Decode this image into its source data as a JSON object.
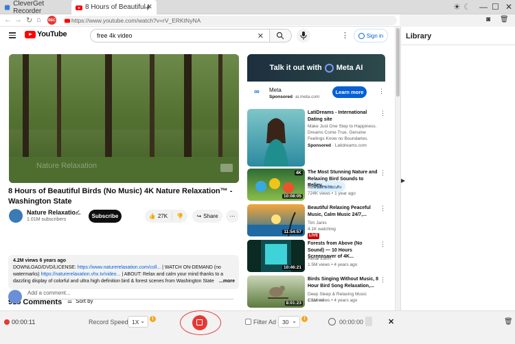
{
  "tabs": [
    {
      "label": "CleverGet Recorder"
    },
    {
      "label": "8 Hours of Beautiful I"
    }
  ],
  "address": {
    "url": "https://www.youtube.com/watch?v=rV_ERKtNyNA",
    "rec_label": "REC"
  },
  "youtube": {
    "logo": "YouTube",
    "search_value": "free 4k video",
    "sign_in": "Sign in"
  },
  "video": {
    "title": "8 Hours of Beautiful Birds (No Music) 4K Nature Relaxation™ - Washington State",
    "watermark": "Nature Relaxation",
    "channel": "Nature Relaxatio...",
    "subscribers": "1.01M subscribers",
    "subscribe": "Subscribe",
    "likes": "27K",
    "share": "Share"
  },
  "description": {
    "meta": "4.2M views  6 years ago",
    "line1_a": "DOWNLOAD/DVD/LICENSE: ",
    "line1_link": "https://www.naturerelaxation.com/coll...",
    "line1_b": " | WATCH ON-DEMAND (no",
    "line2_a": "watermarks) ",
    "line2_link": "https://naturerelaxation.vhx.tv/video...",
    "line2_b": " | ABOUT: Relax and calm your mind thanks to a",
    "line3": "dazzling display of colorful and ultra high definition bird & forest scenes from Washington State",
    "more": "...more"
  },
  "comments": {
    "count": "915 Comments",
    "sort": "Sort by",
    "placeholder": "Add a comment..."
  },
  "ad": {
    "banner": "Talk it out with",
    "banner_brand": "Meta AI",
    "advertiser": "Meta",
    "sponsored": "Sponsored",
    "domain": "· ai.meta.com",
    "learn_more": "Learn more"
  },
  "recommendations": [
    {
      "title": "LatiDreams - International Dating site",
      "desc": "Make Just One Step to Happiness. Dreams Come True. Genuine Feelings Know no Boundaries.",
      "sponsored": "Sponsored",
      "domain": "· Latidreams.com",
      "visit": "Visit site"
    },
    {
      "title": "The Most Stunning Nature and Relaxing Bird Sounds to Reliev...",
      "channel": "Awesome Nature",
      "stats": "724K views  •  1 year ago",
      "duration": "10:08:05",
      "badge": "4K"
    },
    {
      "title": "Beautiful Relaxing Peaceful Music, Calm Music 24/7,...",
      "channel": "Tim Janis",
      "stats": "4.1K watching",
      "live": "LIVE",
      "duration": "11:54:57"
    },
    {
      "title": "Forests from Above (No Sound) — 10 Hours Screensaver of 4K...",
      "channel": "Aerial Earth",
      "stats": "1.5M views  •  4 years ago",
      "duration": "10:46:21"
    },
    {
      "title": "Birds Singing Without Music, 8 Hour Bird Song Relaxation,...",
      "channel": "Deep Sleep & Relaxing Music Channel",
      "stats": "1.1M views  •  4 years ago",
      "duration": "8:01:23"
    }
  ],
  "library": {
    "title": "Library"
  },
  "recorder": {
    "time": "00:00:11",
    "speed_label": "Record Speed :",
    "speed_value": "1X",
    "filter_label": "Filter Ad :",
    "filter_value": "30",
    "timer": "00:00:00"
  },
  "colors": {
    "accent_red": "#e53935",
    "yt_red": "#ff0000",
    "link_blue": "#065fd4"
  }
}
